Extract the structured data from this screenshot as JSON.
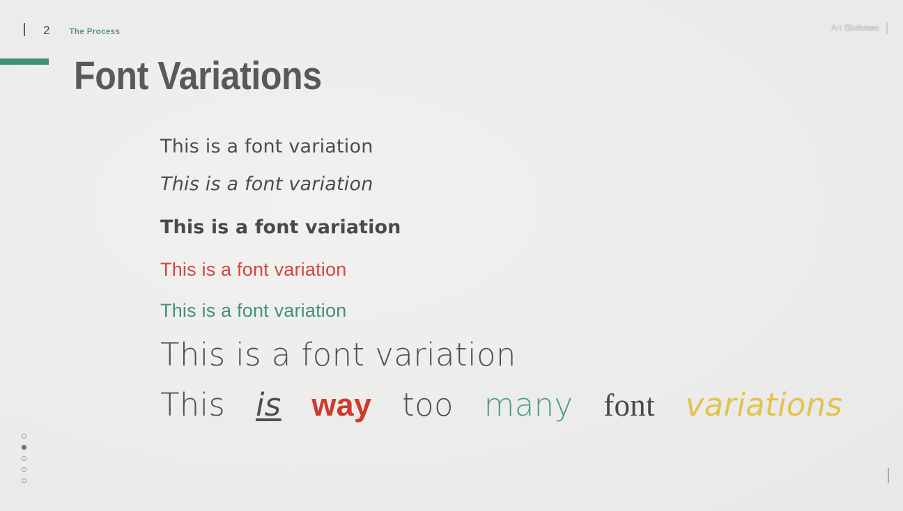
{
  "header": {
    "page_number": "2",
    "section_label": "The Process",
    "right_label": "Art Direction",
    "right_label_ghost": "Software"
  },
  "title": "Font Variations",
  "accent_color": "#3f9178",
  "body_lines": [
    {
      "style": "regular",
      "text": "This is a font variation"
    },
    {
      "style": "italic",
      "text": "This is a font variation"
    },
    {
      "style": "bold",
      "text": "This is a font variation"
    },
    {
      "style": "red",
      "text": "This is a font variation"
    },
    {
      "style": "green",
      "text": "This is a font variation"
    },
    {
      "style": "large-light",
      "text": "This is a font variation"
    }
  ],
  "mixed_line": {
    "word1": "This",
    "word2": "is",
    "word3": "way",
    "word4": "too",
    "word5": "many",
    "word6": "font",
    "word7": "variations"
  },
  "colors": {
    "red": "#d0392e",
    "green": "#4e9b84",
    "yellow": "#e2c34c",
    "text": "#4f4f4f",
    "background": "#eeedec"
  },
  "pagination": {
    "total": 5,
    "active_index": 1
  }
}
